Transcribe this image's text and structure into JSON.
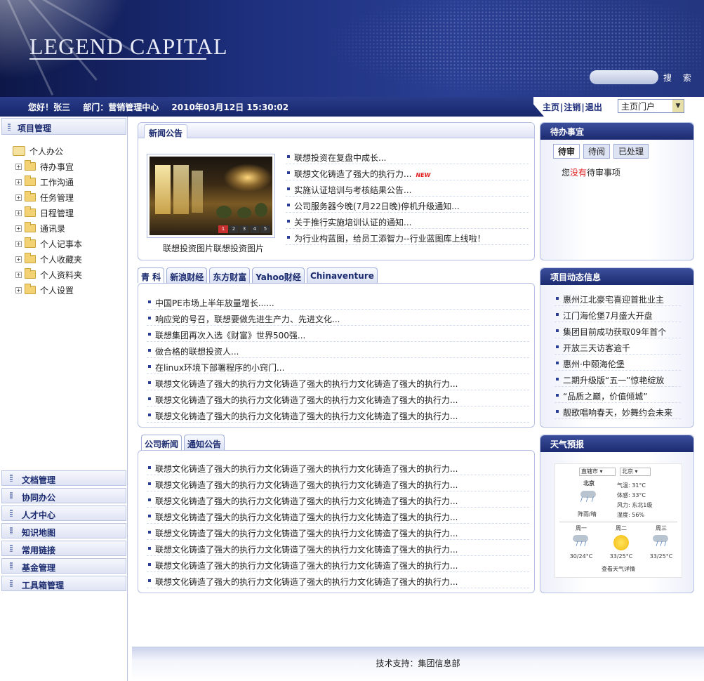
{
  "header": {
    "logo": "LEGEND CAPITAL",
    "search_button": "搜 索"
  },
  "topbar": {
    "greeting": "您好！张三",
    "department": "部门：营销管理中心",
    "datetime": "2010年03月12日  15:30:02",
    "links": [
      "主页",
      "注销",
      "退出"
    ],
    "separator": "|",
    "portal_select": "主页门户"
  },
  "sidebar": {
    "title": "项目管理",
    "root": "个人办公",
    "items": [
      "待办事宜",
      "工作沟通",
      "任务管理",
      "日程管理",
      "通讯录",
      "个人记事本",
      "个人收藏夹",
      "个人资料夹",
      "个人设置"
    ],
    "nav": [
      "文档管理",
      "协同办公",
      "人才中心",
      "知识地图",
      "常用链接",
      "基金管理",
      "工具箱管理"
    ]
  },
  "news": {
    "title": "新闻公告",
    "caption": "联想投资图片联想投资图片",
    "pager": [
      "1",
      "2",
      "3",
      "4",
      "5"
    ],
    "new_badge": "NEW",
    "items": [
      "联想投资在复盘中成长...",
      "联想文化铸造了强大的执行力...",
      "实施认证培训与考核结果公告...",
      "公司服务器今晚(7月22日晚)停机升级通知...",
      "关于推行实施培训认证的通知...",
      "为行业构蓝图，给员工添智力--行业蓝图库上线啦！"
    ]
  },
  "finance": {
    "tabs": [
      "青 科",
      "新浪财经",
      "东方财富",
      "Yahoo财经",
      "Chinaventure"
    ],
    "items": [
      "中国PE市场上半年放量增长......",
      "响应党的号召，联想要做先进生产力、先进文化...",
      "联想集团再次入选《财富》世界500强...",
      "做合格的联想投资人...",
      "在linux环境下部署程序的小窍门...",
      "联想文化铸造了强大的执行力文化铸造了强大的执行力文化铸造了强大的执行力...",
      "联想文化铸造了强大的执行力文化铸造了强大的执行力文化铸造了强大的执行力...",
      "联想文化铸造了强大的执行力文化铸造了强大的执行力文化铸造了强大的执行力..."
    ]
  },
  "company": {
    "tabs": [
      "公司新闻",
      "通知公告"
    ],
    "items": [
      "联想文化铸造了强大的执行力文化铸造了强大的执行力文化铸造了强大的执行力...",
      "联想文化铸造了强大的执行力文化铸造了强大的执行力文化铸造了强大的执行力...",
      "联想文化铸造了强大的执行力文化铸造了强大的执行力文化铸造了强大的执行力...",
      "联想文化铸造了强大的执行力文化铸造了强大的执行力文化铸造了强大的执行力...",
      "联想文化铸造了强大的执行力文化铸造了强大的执行力文化铸造了强大的执行力...",
      "联想文化铸造了强大的执行力文化铸造了强大的执行力文化铸造了强大的执行力...",
      "联想文化铸造了强大的执行力文化铸造了强大的执行力文化铸造了强大的执行力...",
      "联想文化铸造了强大的执行力文化铸造了强大的执行力文化铸造了强大的执行力..."
    ]
  },
  "todo": {
    "title": "待办事宜",
    "tabs": [
      "待审",
      "待阅",
      "已处理"
    ],
    "msg_pre": "您",
    "msg_hl": "没有",
    "msg_post": "待审事项"
  },
  "project": {
    "title": "项目动态信息",
    "items": [
      "惠州江北豪宅喜迎首批业主",
      "江门海伦堡7月盛大开盘",
      "集团目前成功获取09年首个",
      "开放三天访客逾千",
      "惠州·中颐海伦堡",
      "二期升级版“五一”惊艳绽放",
      "“品质之巅，价值倾城”",
      "靓歌唱响春天，妙舞约会未来"
    ]
  },
  "weather": {
    "title": "天气预报",
    "province": "直辖市",
    "city": "北京",
    "city_label": "北京",
    "today_desc": "阵雨/晴",
    "temp": "气温: 31°C",
    "feel": "体感: 33°C",
    "wind": "风力: 东北1级",
    "humidity": "湿度: 56%",
    "days": [
      {
        "name": "周一",
        "temp": "30/24°C"
      },
      {
        "name": "周二",
        "temp": "33/25°C"
      },
      {
        "name": "周三",
        "temp": "33/25°C"
      }
    ],
    "detail": "查看天气详情"
  },
  "footer": {
    "text": "技术支持：集团信息部"
  },
  "colors": {
    "brand": "#1d2f7d",
    "accent": "#e02020"
  }
}
